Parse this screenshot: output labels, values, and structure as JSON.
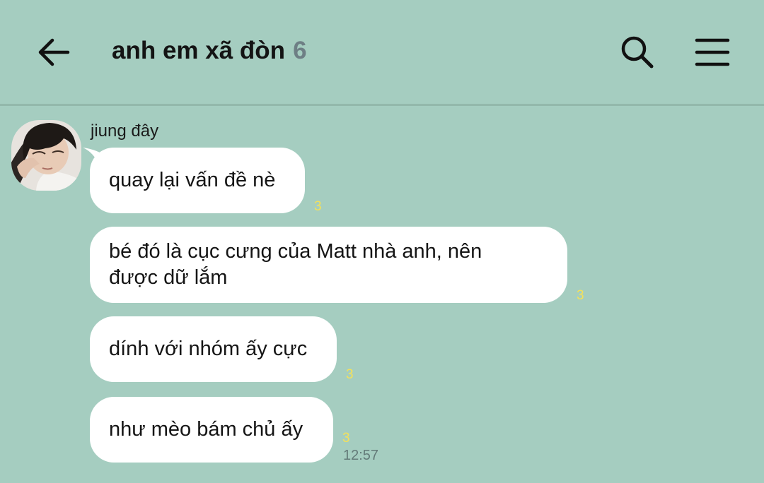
{
  "header": {
    "title": "anh em xã đòn",
    "member_count": "6",
    "back_icon": "arrow-left-icon",
    "search_icon": "search-icon",
    "menu_icon": "hamburger-menu-icon"
  },
  "colors": {
    "background": "#a5cdc0",
    "bubble": "#ffffff",
    "unread_count": "#f4e15a",
    "member_count": "#6e7f85"
  },
  "chat": {
    "sender_name": "jiung đây",
    "messages": [
      {
        "text": "quay lại vấn đề nè",
        "unread": "3"
      },
      {
        "text": "bé đó là cục cưng của Matt nhà anh, nên được dữ lắm",
        "unread": "3"
      },
      {
        "text": "dính với nhóm ấy cực",
        "unread": "3"
      },
      {
        "text": "như mèo bám chủ ấy",
        "unread": "3",
        "time": "12:57"
      }
    ]
  }
}
